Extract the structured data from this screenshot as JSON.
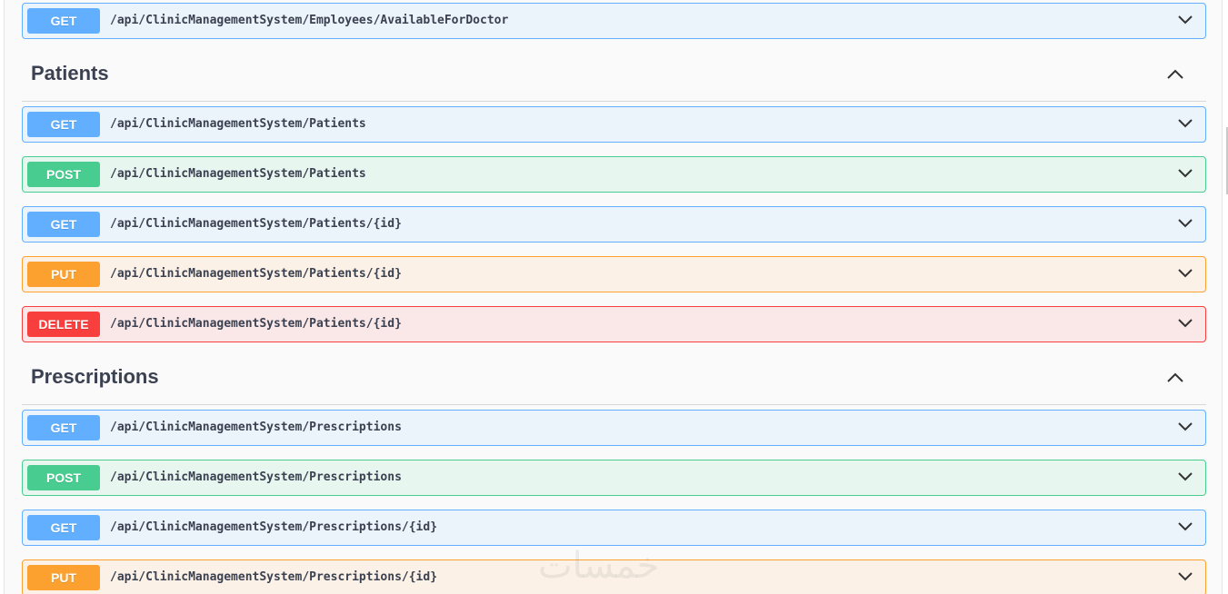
{
  "operations_top": [
    {
      "method": "GET",
      "path": "/api/ClinicManagementSystem/Employees/AvailableForDoctor",
      "type": "get"
    }
  ],
  "sections": [
    {
      "title": "Patients",
      "operations": [
        {
          "method": "GET",
          "path": "/api/ClinicManagementSystem/Patients",
          "type": "get"
        },
        {
          "method": "POST",
          "path": "/api/ClinicManagementSystem/Patients",
          "type": "post"
        },
        {
          "method": "GET",
          "path": "/api/ClinicManagementSystem/Patients/{id}",
          "type": "get"
        },
        {
          "method": "PUT",
          "path": "/api/ClinicManagementSystem/Patients/{id}",
          "type": "put"
        },
        {
          "method": "DELETE",
          "path": "/api/ClinicManagementSystem/Patients/{id}",
          "type": "delete"
        }
      ]
    },
    {
      "title": "Prescriptions",
      "operations": [
        {
          "method": "GET",
          "path": "/api/ClinicManagementSystem/Prescriptions",
          "type": "get"
        },
        {
          "method": "POST",
          "path": "/api/ClinicManagementSystem/Prescriptions",
          "type": "post"
        },
        {
          "method": "GET",
          "path": "/api/ClinicManagementSystem/Prescriptions/{id}",
          "type": "get"
        },
        {
          "method": "PUT",
          "path": "/api/ClinicManagementSystem/Prescriptions/{id}",
          "type": "put"
        }
      ]
    }
  ],
  "colors": {
    "get": "#61affe",
    "post": "#49cc90",
    "put": "#fca130",
    "delete": "#f93e3e"
  },
  "watermark_text": "خمسات"
}
